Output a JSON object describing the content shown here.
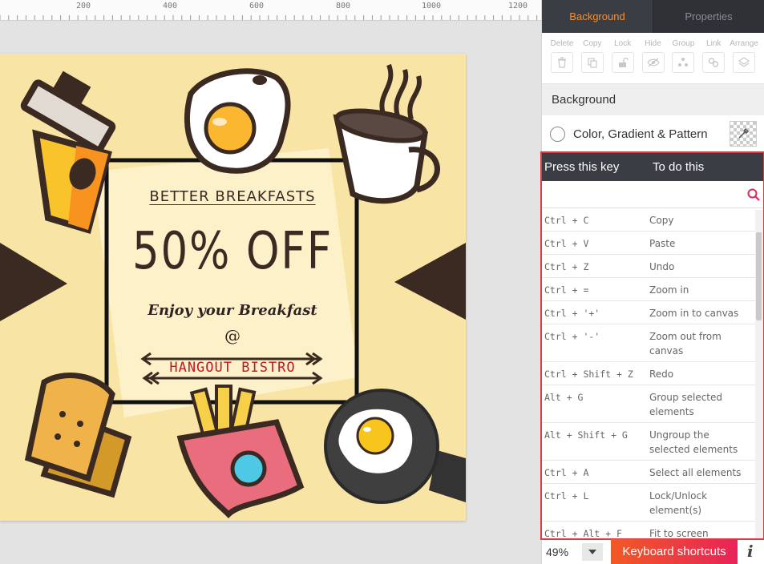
{
  "ruler": {
    "labels": [
      "200",
      "400",
      "600",
      "800",
      "1000",
      "1200"
    ]
  },
  "poster": {
    "title": "BETTER BREAKFASTS",
    "offer": "50% OFF",
    "tagline": "Enjoy your Breakfast",
    "at": "@",
    "bistro": "HANGOUT BISTRO",
    "colors": {
      "background": "#f8e4a4",
      "ink": "#3b2a22",
      "accent": "#c4162a"
    }
  },
  "panel": {
    "tabs": [
      {
        "label": "Background",
        "active": true
      },
      {
        "label": "Properties",
        "active": false
      }
    ],
    "tools": [
      {
        "label": "Delete",
        "icon": "trash-icon"
      },
      {
        "label": "Copy",
        "icon": "copy-icon"
      },
      {
        "label": "Lock",
        "icon": "lock-icon"
      },
      {
        "label": "Hide",
        "icon": "eye-off-icon"
      },
      {
        "label": "Group",
        "icon": "group-icon"
      },
      {
        "label": "Link",
        "icon": "link-icon"
      },
      {
        "label": "Arrange",
        "icon": "layers-icon"
      }
    ],
    "section_title": "Background",
    "bg_option_label": "Color, Gradient & Pattern"
  },
  "shortcuts": {
    "col_key": "Press this key",
    "col_action": "To do this",
    "search_placeholder": "",
    "rows": [
      {
        "key": "Ctrl + C",
        "action": "Copy"
      },
      {
        "key": "Ctrl + V",
        "action": "Paste"
      },
      {
        "key": "Ctrl + Z",
        "action": "Undo"
      },
      {
        "key": "Ctrl + =",
        "action": "Zoom in"
      },
      {
        "key": "Ctrl + '+'",
        "action": "Zoom in to canvas"
      },
      {
        "key": "Ctrl + '-'",
        "action": "Zoom out from canvas"
      },
      {
        "key": "Ctrl + Shift + Z",
        "action": "Redo"
      },
      {
        "key": "Alt + G",
        "action": "Group selected elements"
      },
      {
        "key": "Alt + Shift + G",
        "action": "Ungroup the selected elements"
      },
      {
        "key": "Ctrl + A",
        "action": "Select all elements"
      },
      {
        "key": "Ctrl + L",
        "action": "Lock/Unlock element(s)"
      },
      {
        "key": "Ctrl + Alt + F",
        "action": "Fit to screen"
      }
    ]
  },
  "bottom": {
    "zoom": "49%",
    "keyboard_shortcuts_label": "Keyboard shortcuts",
    "info_label": "i"
  }
}
